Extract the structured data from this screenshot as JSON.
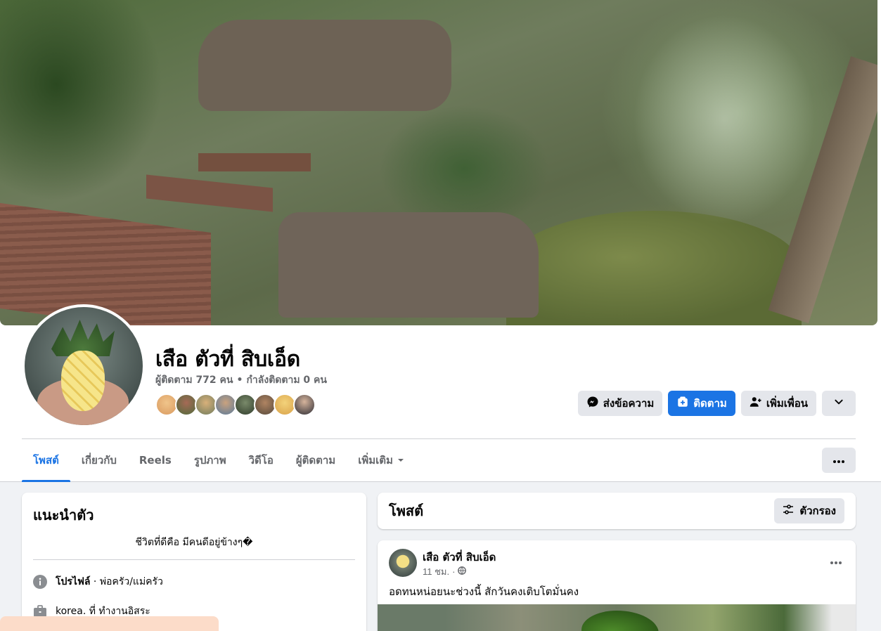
{
  "profile": {
    "name": "เสือ ตัวที่ สิบเอ็ด",
    "followers_text": "ผู้ติดตาม 772 คน",
    "following_text": "กำลังติดตาม 0 คน",
    "separator": "•"
  },
  "actions": {
    "message_label": "ส่งข้อความ",
    "follow_label": "ติดตาม",
    "add_friend_label": "เพิ่มเพื่อน"
  },
  "tabs": [
    {
      "label": "โพสต์"
    },
    {
      "label": "เกี่ยวกับ"
    },
    {
      "label": "Reels"
    },
    {
      "label": "รูปภาพ"
    },
    {
      "label": "วิดีโอ"
    },
    {
      "label": "ผู้ติดตาม"
    },
    {
      "label": "เพิ่มเติม"
    }
  ],
  "intro": {
    "title": "แนะนำตัว",
    "bio": "ชีวิตที่ดีคือ มีคนดีอยู่ข้างๆ�",
    "profile_label": "โปรไฟล์",
    "profile_value": " · พ่อครัว/แม่ครัว",
    "work": "korea. ที่ ทำงานอิสระ"
  },
  "posts_header": {
    "title": "โพสต์",
    "filter_label": "ตัวกรอง"
  },
  "post": {
    "author": "เสือ ตัวที่ สิบเอ็ด",
    "time": "11 ชม.",
    "meta_sep": "·",
    "text": "อดทนหน่อยนะช่วงนี้ สักวันคงเติบโตมั่นคง"
  },
  "colors": {
    "accent": "#1b74e4",
    "page_bg": "#f0f2f5",
    "button_gray": "#e4e6eb",
    "secondary_text": "#65676b"
  }
}
